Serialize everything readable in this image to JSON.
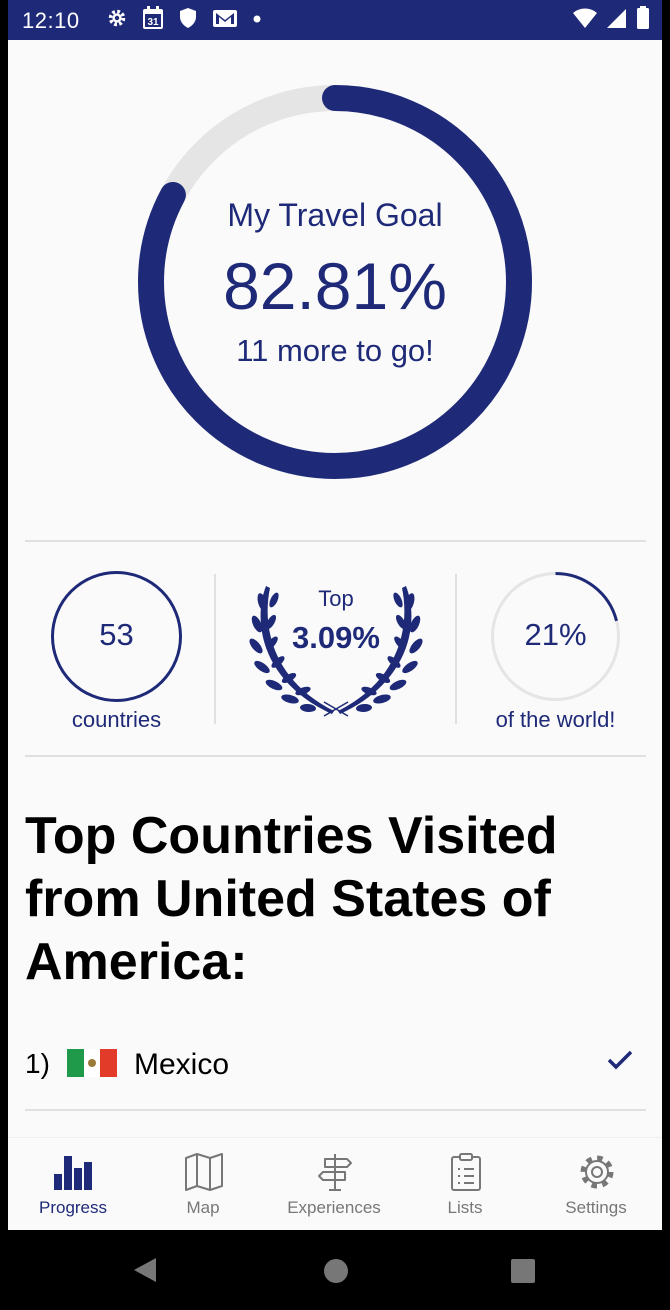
{
  "status_bar": {
    "time": "12:10",
    "calendar_day": "31"
  },
  "goal": {
    "label": "My Travel Goal",
    "percent_text": "82.81%",
    "percent_value": 82.81,
    "remaining_text": "11 more to go!"
  },
  "stats": {
    "countries_count": "53",
    "countries_label": "countries",
    "rank_prefix": "Top",
    "rank_value": "3.09%",
    "world_percent_text": "21%",
    "world_percent_value": 21,
    "world_label": "of the world!"
  },
  "top_countries": {
    "heading": "Top Countries Visited from United States of America:",
    "items": [
      {
        "rank": "1)",
        "name": "Mexico",
        "flag": "mexico-flag",
        "visited": true
      }
    ]
  },
  "bottom_nav": {
    "items": [
      {
        "label": "Progress",
        "icon": "bar-chart-icon",
        "active": true
      },
      {
        "label": "Map",
        "icon": "map-icon",
        "active": false
      },
      {
        "label": "Experiences",
        "icon": "signpost-icon",
        "active": false
      },
      {
        "label": "Lists",
        "icon": "clipboard-list-icon",
        "active": false
      },
      {
        "label": "Settings",
        "icon": "gear-icon",
        "active": false
      }
    ]
  },
  "colors": {
    "primary": "#1e2a78",
    "track": "#e5e5e5",
    "background": "#fafafa"
  }
}
